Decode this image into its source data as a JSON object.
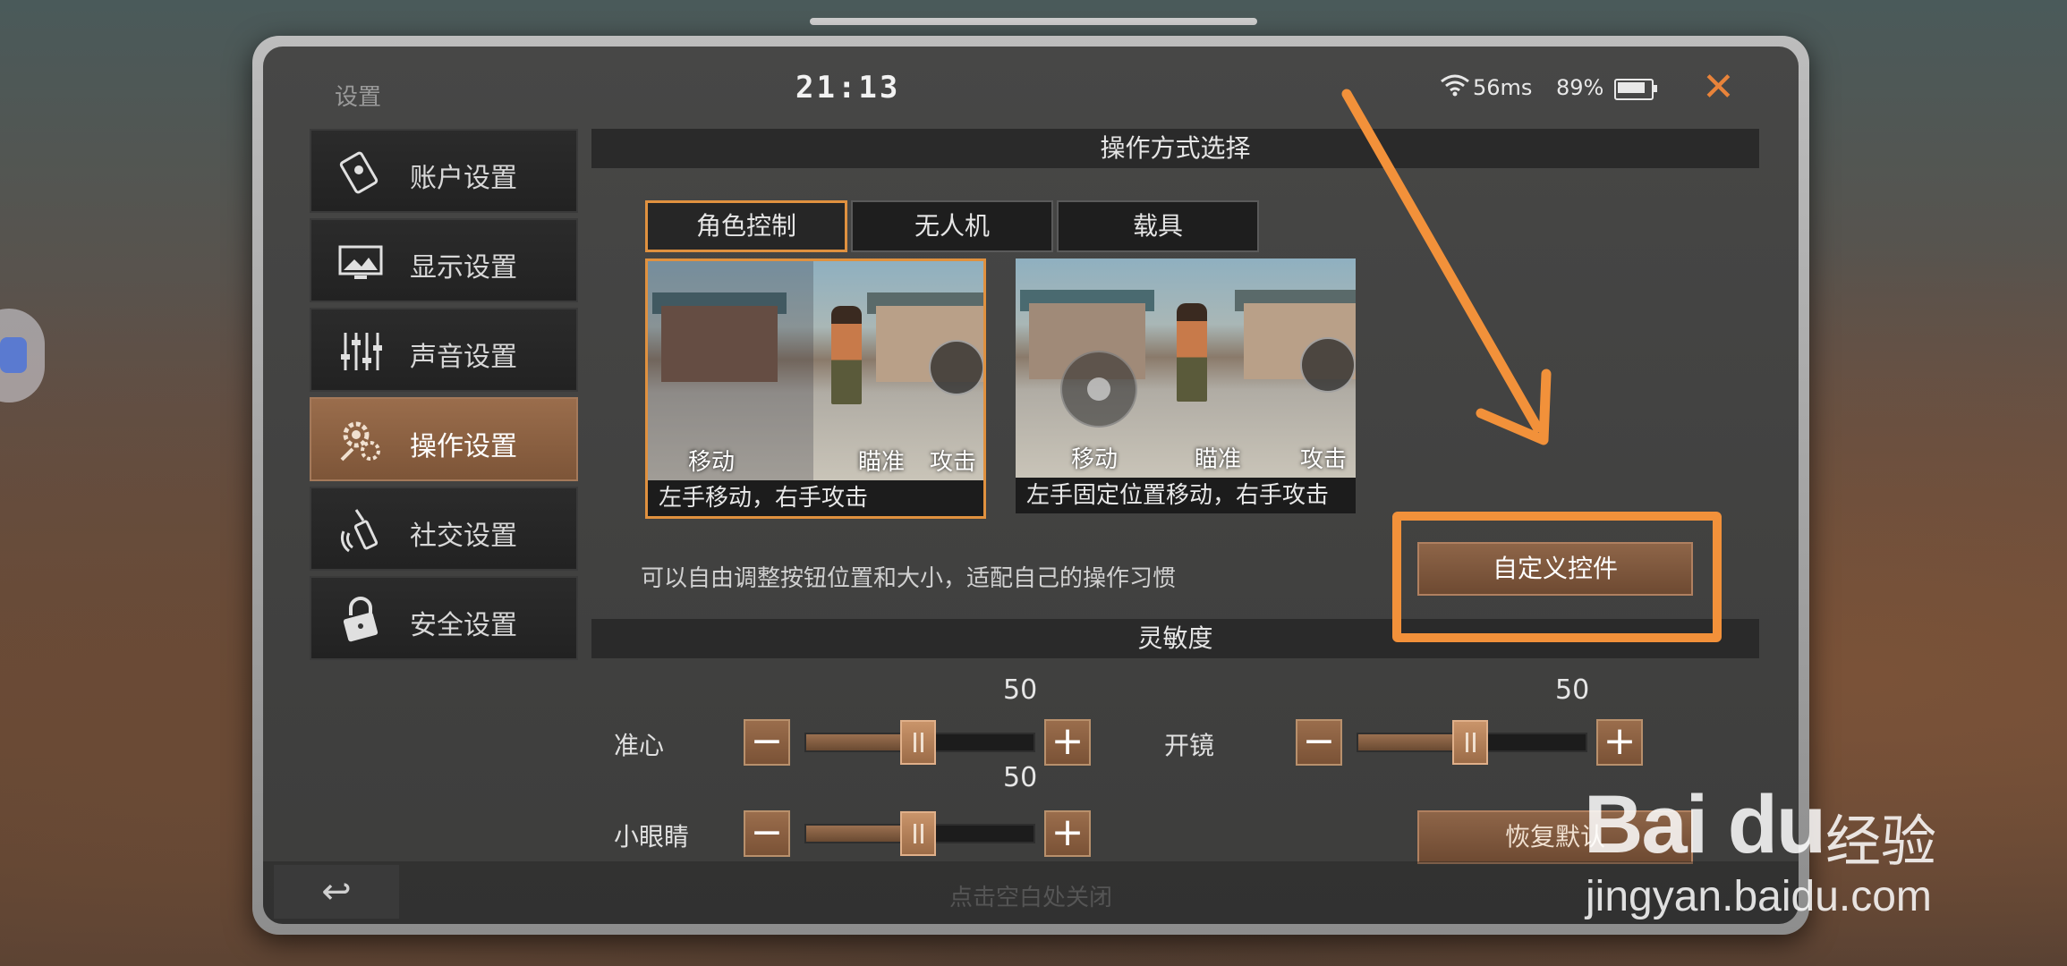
{
  "status": {
    "title": "设置",
    "time": "21:13",
    "ping": "56ms",
    "battery": "89%",
    "close_glyph": "✕"
  },
  "sidebar": {
    "items": [
      {
        "label": "账户设置",
        "icon": "account-icon"
      },
      {
        "label": "显示设置",
        "icon": "display-icon"
      },
      {
        "label": "声音设置",
        "icon": "sound-icon"
      },
      {
        "label": "操作设置",
        "icon": "controls-icon",
        "active": true
      },
      {
        "label": "社交设置",
        "icon": "social-icon"
      },
      {
        "label": "安全设置",
        "icon": "security-icon"
      }
    ]
  },
  "main": {
    "control_header": "操作方式选择",
    "tabs": [
      {
        "label": "角色控制",
        "active": true
      },
      {
        "label": "无人机"
      },
      {
        "label": "载具"
      }
    ],
    "modes": [
      {
        "caption": "左手移动，右手攻击",
        "move": "移动",
        "aim": "瞄准",
        "attack": "攻击",
        "selected": true
      },
      {
        "caption": "左手固定位置移动，右手攻击",
        "move": "移动",
        "aim": "瞄准",
        "attack": "攻击"
      }
    ],
    "hint": "可以自由调整按钮位置和大小，适配自己的操作习惯",
    "custom_button": "自定义控件",
    "sensitivity_header": "灵敏度",
    "sliders": [
      {
        "label": "准心",
        "value": "50",
        "minus": "−",
        "plus": "+"
      },
      {
        "label": "开镜",
        "value": "50",
        "minus": "−",
        "plus": "+"
      },
      {
        "label": "小眼睛",
        "value": "50",
        "minus": "−",
        "plus": "+"
      }
    ],
    "restore_button": "恢复默认"
  },
  "bottom": {
    "back_glyph": "↩",
    "close_hint": "点击空白处关闭"
  },
  "watermark": {
    "logo": "Bai du",
    "brand": "经验",
    "url": "jingyan.baidu.com"
  },
  "colors": {
    "accent": "#e0913f",
    "active_item": "#8a5f42",
    "annotation": "#f2913a"
  }
}
